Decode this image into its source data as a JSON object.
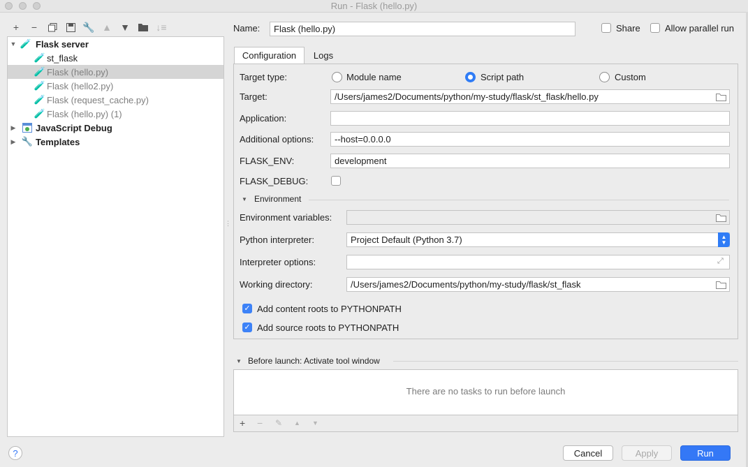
{
  "window": {
    "title": "Run - Flask (hello.py)"
  },
  "toolbar": {
    "icons": [
      "plus-icon",
      "minus-icon",
      "copy-icon",
      "save-icon",
      "wrench-icon",
      "arrow-up-icon",
      "arrow-down-icon",
      "folder-add-icon",
      "sort-icon"
    ]
  },
  "tree": {
    "groups": [
      {
        "label": "Flask server",
        "expanded": true,
        "children": [
          {
            "label": "st_flask",
            "selected": false,
            "temporary": false
          },
          {
            "label": "Flask (hello.py)",
            "selected": true,
            "temporary": true
          },
          {
            "label": "Flask (hello2.py)",
            "selected": false,
            "temporary": true
          },
          {
            "label": "Flask (request_cache.py)",
            "selected": false,
            "temporary": true
          },
          {
            "label": "Flask (hello.py) (1)",
            "selected": false,
            "temporary": true
          }
        ]
      },
      {
        "label": "JavaScript Debug",
        "expanded": false
      },
      {
        "label": "Templates",
        "expanded": false
      }
    ]
  },
  "header": {
    "name_label": "Name:",
    "name_value": "Flask (hello.py)",
    "share_label": "Share",
    "share_checked": false,
    "parallel_label": "Allow parallel run",
    "parallel_checked": false
  },
  "tabs": [
    {
      "label": "Configuration",
      "active": true
    },
    {
      "label": "Logs",
      "active": false
    }
  ],
  "config": {
    "target_type_label": "Target type:",
    "target_type_options": [
      "Module name",
      "Script path",
      "Custom"
    ],
    "target_type_selected": "Script path",
    "target_label": "Target:",
    "target_value": "/Users/james2/Documents/python/my-study/flask/st_flask/hello.py",
    "application_label": "Application:",
    "application_value": "",
    "additional_options_label": "Additional options:",
    "additional_options_value": "--host=0.0.0.0",
    "flask_env_label": "FLASK_ENV:",
    "flask_env_value": "development",
    "flask_debug_label": "FLASK_DEBUG:",
    "flask_debug_checked": false,
    "environment_section": "Environment",
    "env_vars_label": "Environment variables:",
    "env_vars_value": "",
    "python_interpreter_label": "Python interpreter:",
    "python_interpreter_value": "Project Default (Python 3.7)",
    "interpreter_options_label": "Interpreter options:",
    "interpreter_options_value": "",
    "working_dir_label": "Working directory:",
    "working_dir_value": "/Users/james2/Documents/python/my-study/flask/st_flask",
    "content_roots_label": "Add content roots to PYTHONPATH",
    "content_roots_checked": true,
    "source_roots_label": "Add source roots to PYTHONPATH",
    "source_roots_checked": true
  },
  "before_launch": {
    "title": "Before launch: Activate tool window",
    "empty_text": "There are no tasks to run before launch"
  },
  "footer": {
    "help_label": "?",
    "cancel_label": "Cancel",
    "apply_label": "Apply",
    "run_label": "Run"
  },
  "colors": {
    "accent": "#3478f6",
    "selection": "#d5d5d5",
    "window_bg": "#ececec"
  }
}
